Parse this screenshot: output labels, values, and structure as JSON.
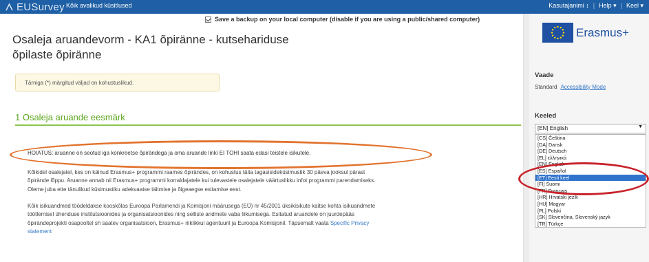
{
  "header": {
    "logo_text": "EUSurvey",
    "logo_icon": "eusurvey-logo-icon",
    "public_surveys_link": "Kõik avalikud küsitlused",
    "user_menu": [
      {
        "label": "Kasutajanimi ↕"
      },
      {
        "label": "Help ▾"
      },
      {
        "label": "Keel ▾"
      }
    ]
  },
  "form": {
    "backup_checkbox_label": "Save a backup on your local computer (disable if you are using a public/shared computer)",
    "backup_checked": true,
    "title_line1": "Osaleja aruandevorm - KA1 õpiränne - kutsehariduse",
    "title_line2": "õpilaste õpiränne",
    "required_note": "Tärniga (*) märgitud väljad on kohustuslikud.",
    "section_title": "1 Osaleja aruande eesmärk",
    "warning": "HOIATUS: aruanne on seotud iga konkreetse õpirändega ja oma aruande linki EI TOHI saata edasi teistele isikutele.",
    "para1_lines": [
      "Kõikidel osalejatel, kes on käinud Erasmus+ programmi raames õpirändes, on kohustus täita tagasisideküsimustik 30 päeva jooksul pärast",
      "õpirände lõppu. Aruanne annab nii Erasmus+ programmi korraldajatele kui tulevastele osalejatele väärtuslikku infot programmi parendamiseks.",
      "Oleme juba ette tänulikud küsimustiku adekvaatse täitmise ja õigeaegse esitamise eest."
    ],
    "para2_lines": [
      "Kõik isikuandmed töödeldakse kooskõlas Euroopa Parlamendi ja Komisjoni määrusega (EÜ) nr 45/2001 üksikisikute kaitse kohta isikuandmete",
      "töötlemisel ühenduse institutsioonides ja organisatsioonides ning selliste andmete vaba liikumisega. Esitatud aruandele on juurdepääs",
      "õpirändeprojekti osapooltel sh saatev organisatsioon, Erasmus+ riiklikkul agentuuril ja Euroopa Komisjonil. Täpsemalt vaata"
    ],
    "privacy_link_part1": "Specific Privacy",
    "privacy_link_part2": "statement"
  },
  "sidebar": {
    "brand_text": "Erasmus+",
    "brand_icon": "eu-flag-icon",
    "view_heading": "Vaade",
    "view_standard": "Standard",
    "view_accessibility": "Accessibility Mode",
    "languages_heading": "Keeled",
    "selected_language": "[EN] English",
    "language_options": [
      {
        "label": "[CS] Čeština",
        "selected": false
      },
      {
        "label": "[DA] Dansk",
        "selected": false
      },
      {
        "label": "[DE] Deutsch",
        "selected": false
      },
      {
        "label": "[EL] ελληνικά",
        "selected": false
      },
      {
        "label": "[EN] English",
        "selected": false
      },
      {
        "label": "[ES] Español",
        "selected": false
      },
      {
        "label": "[ET] Eesti keel",
        "selected": true
      },
      {
        "label": "[FI] Suomi",
        "selected": false
      },
      {
        "label": "[FR] Français",
        "selected": false
      },
      {
        "label": "[HR] Hrvatski jezik",
        "selected": false
      },
      {
        "label": "[HU] Magyar",
        "selected": false
      },
      {
        "label": "[PL] Polski",
        "selected": false
      },
      {
        "label": "[SK] Slovenčina, Slovenský jazyk",
        "selected": false
      },
      {
        "label": "[TR] Türkçe",
        "selected": false
      }
    ]
  },
  "annotations": {
    "warning_highlight_color": "#e2732e",
    "language_highlight_color": "#c8232b"
  },
  "colors": {
    "topbar": "#1e5fa5",
    "section_green": "#5ba51c",
    "link_blue": "#3578c6",
    "selected_option": "#2f73cc",
    "note_background": "#fcf8e3"
  }
}
